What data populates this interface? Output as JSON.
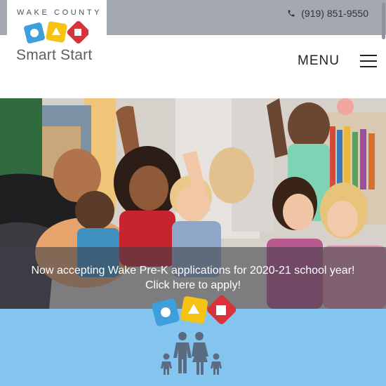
{
  "header": {
    "phone": "(919) 851-9550",
    "phone_icon": "phone-icon",
    "logo": {
      "county_text": "WAKE COUNTY",
      "brand_text": "Smart Start",
      "shape_colors": {
        "circle": "#3d9fdb",
        "triangle": "#f6c314",
        "square": "#d8333a"
      }
    },
    "menu_label": "MENU",
    "menu_icon": "hamburger-icon"
  },
  "hero": {
    "image": "children-raising-hands-photo",
    "announcement_line1": "Now accepting Wake Pre-K applications for 2020-21 school year!",
    "announcement_line2": "Click here to apply!"
  },
  "panel": {
    "background": "#83c5ee",
    "family_icon": "family-icon",
    "family_color": "#5a6b82"
  }
}
